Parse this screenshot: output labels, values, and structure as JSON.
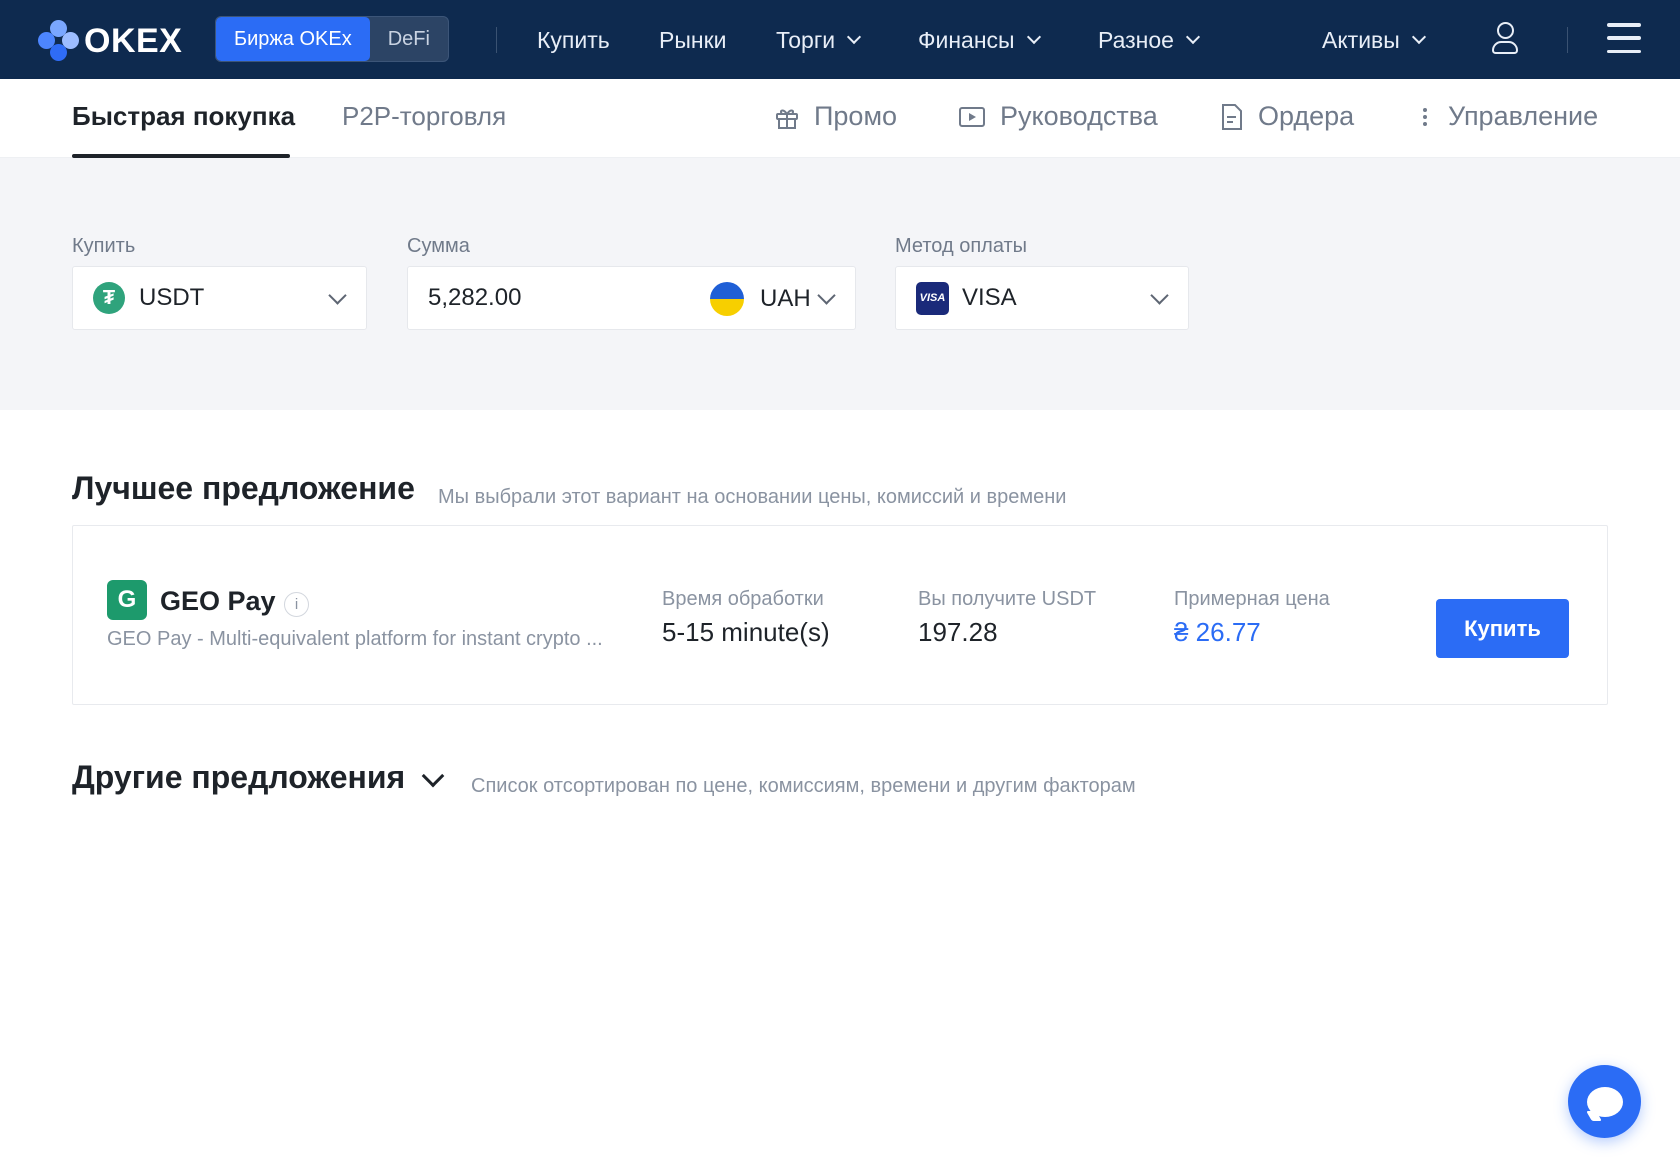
{
  "brand": {
    "logo_text": "OKEX",
    "accent": "#2b6cf5",
    "nav_bg": "#0e2a4f"
  },
  "topnav": {
    "segment": [
      "Биржа OKEx",
      "DeFi"
    ],
    "links": [
      "Купить",
      "Рынки",
      "Торги",
      "Финансы",
      "Разное"
    ],
    "assets": "Активы"
  },
  "subnav": {
    "tabs": [
      "Быстрая покупка",
      "P2P-торговля"
    ],
    "actions": [
      "Промо",
      "Руководства",
      "Ордера",
      "Управление"
    ]
  },
  "form": {
    "buy_label": "Купить",
    "buy_value": "USDT",
    "amount_label": "Сумма",
    "amount_value": "5,282.00",
    "amount_currency": "UAH",
    "method_label": "Метод оплаты",
    "method_value": "VISA",
    "visa_badge": "VISA"
  },
  "best": {
    "title": "Лучшее предложение",
    "subtitle": "Мы выбрали этот вариант на основании цены, комиссий и времени",
    "provider": "GEO Pay",
    "description": "GEO Pay - Multi-equivalent platform for instant crypto ...",
    "time_label": "Время обработки",
    "time_value": "5-15 minute(s)",
    "receive_label": "Вы получите USDT",
    "receive_value": "197.28",
    "price_label": "Примерная цена",
    "price_value": "₴ 26.77",
    "buy_button": "Купить"
  },
  "other": {
    "title": "Другие предложения",
    "subtitle": "Список отсортирован по цене, комиссиям, времени и другим факторам"
  }
}
